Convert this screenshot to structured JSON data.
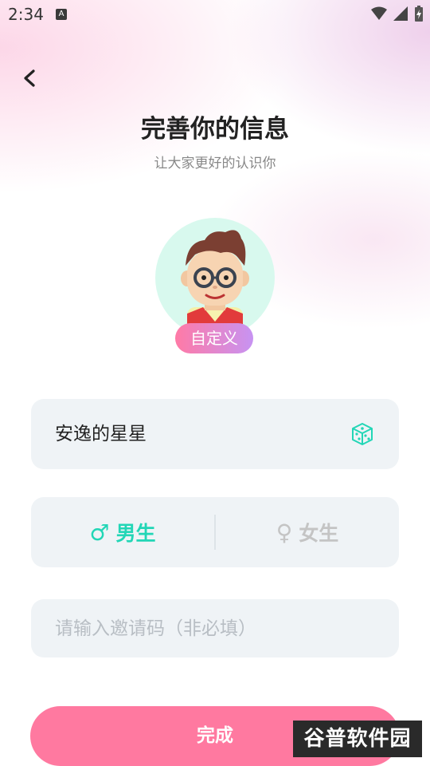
{
  "status_bar": {
    "time": "2:34",
    "notif_letter": "A"
  },
  "header": {
    "title": "完善你的信息",
    "subtitle": "让大家更好的认识你"
  },
  "avatar": {
    "badge_label": "自定义"
  },
  "nickname": {
    "value": "安逸的星星"
  },
  "gender": {
    "male_symbol": "♂",
    "male_label": "男生",
    "female_symbol": "♀",
    "female_label": "女生",
    "selected": "male"
  },
  "invite": {
    "placeholder": "请输入邀请码（非必填）"
  },
  "actions": {
    "done_label": "完成"
  },
  "watermark": {
    "text": "谷普软件园"
  },
  "colors": {
    "accent_green": "#22d6b6",
    "button_pink": "#ff79a0",
    "field_bg": "#eff3f6"
  }
}
